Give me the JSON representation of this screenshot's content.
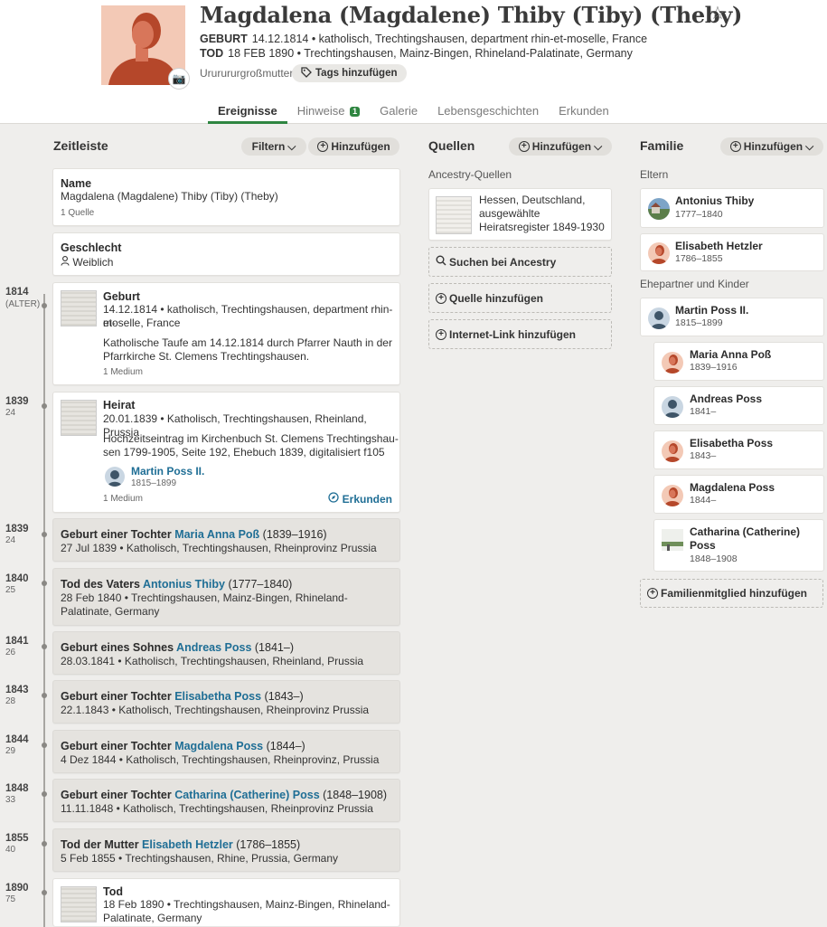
{
  "person": {
    "name": "Magdalena (Magdalene) Thiby (Tiby) (Theby)",
    "birth_label": "GEBURT",
    "birth_value": "14.12.1814 • katholisch, Trechtingshausen, department rhin-et-moselle, France",
    "death_label": "TOD",
    "death_value": "18 FEB 1890 • Trechtingshausen, Mainz-Bingen, Rhineland-Palatinate, Germany",
    "relation": "Ururururgroßmutter",
    "tags_button": "Tags hinzufügen"
  },
  "tabs": [
    {
      "label": "Ereignisse"
    },
    {
      "label": "Hinweise",
      "badge": "1"
    },
    {
      "label": "Galerie"
    },
    {
      "label": "Lebensgeschichten"
    },
    {
      "label": "Erkunden"
    }
  ],
  "timeline": {
    "title": "Zeitleiste",
    "filter_button": "Filtern",
    "add_button": "Hinzufügen",
    "name_card": {
      "title": "Name",
      "value": "Magdalena (Magdalene) Thiby (Tiby) (Theby)",
      "meta": "1 Quelle"
    },
    "gender_card": {
      "title": "Geschlecht",
      "value": "Weiblich"
    },
    "years": [
      {
        "year": "1814",
        "age": "(ALTER)"
      },
      {
        "year": "1839",
        "age": "24"
      },
      {
        "year": "1839",
        "age": "24"
      },
      {
        "year": "1840",
        "age": "25"
      },
      {
        "year": "1841",
        "age": "26"
      },
      {
        "year": "1843",
        "age": "28"
      },
      {
        "year": "1844",
        "age": "29"
      },
      {
        "year": "1848",
        "age": "33"
      },
      {
        "year": "1855",
        "age": "40"
      },
      {
        "year": "1890",
        "age": "75"
      }
    ],
    "birth": {
      "title": "Geburt",
      "line1": "14.12.1814 • katholisch, Trechtingshausen, department rhin-et-",
      "line2": "moselle, France",
      "note1": "Katholische Taufe am 14.12.1814 durch Pfarrer Nauth in der",
      "note2": "Pfarrkirche St. Clemens Trechtingshausen.",
      "meta": "1 Medium"
    },
    "marriage": {
      "title": "Heirat",
      "line1": "20.01.1839 • Katholisch, Trechtingshausen, Rheinland, Prussia",
      "note1": "Hochzeitseintrag im Kirchenbuch St. Clemens Trechtingshau-",
      "note2": "sen 1799-1905, Seite 192, Ehebuch 1839, digitalisiert f105",
      "spouse_name": "Martin Poss II.",
      "spouse_dates": "1815–1899",
      "meta": "1 Medium",
      "explore": "Erkunden"
    },
    "events": [
      {
        "prefix": "Geburt einer Tochter ",
        "link": "Maria Anna Poß",
        "suffix": " (1839–1916)",
        "detail1": "27 Jul 1839 • Katholisch, Trechtingshausen, Rheinprovinz Prussia",
        "detail2": ""
      },
      {
        "prefix": "Tod des Vaters ",
        "link": "Antonius Thiby",
        "suffix": " (1777–1840)",
        "detail1": "28 Feb 1840 • Trechtingshausen, Mainz-Bingen, Rhineland-",
        "detail2": "Palatinate, Germany"
      },
      {
        "prefix": "Geburt eines Sohnes ",
        "link": "Andreas Poss",
        "suffix": " (1841–)",
        "detail1": "28.03.1841 • Katholisch, Trechtingshausen, Rheinland, Prussia",
        "detail2": ""
      },
      {
        "prefix": "Geburt einer Tochter ",
        "link": "Elisabetha Poss",
        "suffix": " (1843–)",
        "detail1": "22.1.1843 • Katholisch, Trechtingshausen, Rheinprovinz Prussia",
        "detail2": ""
      },
      {
        "prefix": "Geburt einer Tochter ",
        "link": "Magdalena Poss",
        "suffix": " (1844–)",
        "detail1": "4 Dez 1844 • Katholisch, Trechtingshausen, Rheinprovinz, Prussia",
        "detail2": ""
      },
      {
        "prefix": "Geburt einer Tochter ",
        "link": "Catharina (Catherine) Poss",
        "suffix": " (1848–1908)",
        "detail1": "11.11.1848 • Katholisch, Trechtingshausen, Rheinprovinz Prussia",
        "detail2": ""
      },
      {
        "prefix": "Tod der Mutter ",
        "link": "Elisabeth Hetzler",
        "suffix": " (1786–1855)",
        "detail1": "5 Feb 1855 • Trechtingshausen, Rhine, Prussia, Germany",
        "detail2": ""
      }
    ],
    "death": {
      "title": "Tod",
      "line1": "18 Feb 1890 • Trechtingshausen, Mainz-Bingen, Rhineland-",
      "line2": "Palatinate, Germany"
    }
  },
  "sources": {
    "title": "Quellen",
    "add_button": "Hinzufügen",
    "group_label": "Ancestry-Quellen",
    "record": {
      "line1": "Hessen, Deutschland,",
      "line2": "ausgewählte",
      "line3": "Heiratsregister 1849-1930"
    },
    "search_button": "Suchen bei Ancestry",
    "add_source": "Quelle hinzufügen",
    "add_link": "Internet-Link hinzufügen"
  },
  "family": {
    "title": "Familie",
    "add_button": "Hinzufügen",
    "parents_label": "Eltern",
    "parents": [
      {
        "name": "Antonius Thiby",
        "dates": "1777–1840",
        "gender": "male"
      },
      {
        "name": "Elisabeth Hetzler",
        "dates": "1786–1855",
        "gender": "female"
      }
    ],
    "spouses_label": "Ehepartner und Kinder",
    "spouse": {
      "name": "Martin Poss II.",
      "dates": "1815–1899",
      "gender": "male"
    },
    "children": [
      {
        "name": "Maria Anna Poß",
        "name2": "",
        "dates": "1839–1916",
        "gender": "female"
      },
      {
        "name": "Andreas Poss",
        "name2": "",
        "dates": "1841–",
        "gender": "male"
      },
      {
        "name": "Elisabetha Poss",
        "name2": "",
        "dates": "1843–",
        "gender": "female"
      },
      {
        "name": "Magdalena Poss",
        "name2": "",
        "dates": "1844–",
        "gender": "female"
      },
      {
        "name": "Catharina (Catherine)",
        "name2": "Poss",
        "dates": "1848–1908",
        "gender": "photo"
      }
    ],
    "add_member": "Familienmitglied hinzufügen"
  },
  "colors": {
    "accent_green": "#2e8540",
    "link_blue": "#1f6e95",
    "female_avatar": "#e8a58c",
    "male_avatar": "#9db3c8"
  }
}
